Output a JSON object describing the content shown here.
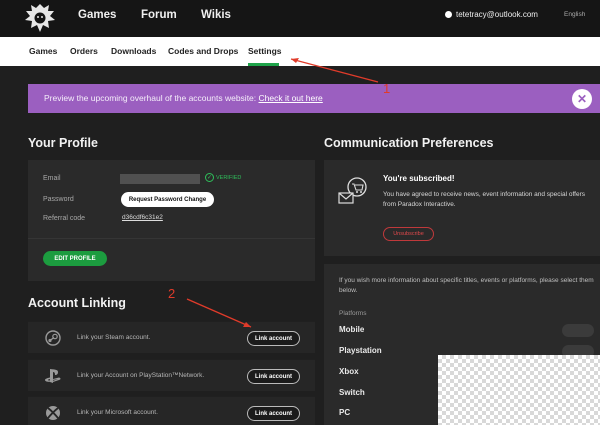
{
  "topbar": {
    "nav": [
      "Games",
      "Forum",
      "Wikis"
    ],
    "account_email": "tetetracy@outlook.com",
    "language": "English",
    "logo_icon": "lion-logo-icon"
  },
  "subnav": {
    "items": [
      "Games",
      "Orders",
      "Downloads",
      "Codes and Drops",
      "Settings"
    ],
    "active": "Settings",
    "active_color": "#1fa34a"
  },
  "banner": {
    "text": "Preview the upcoming overhaul of the accounts website: ",
    "link": "Check it out here",
    "close": "✕",
    "color": "#9b5fc0"
  },
  "profile": {
    "title": "Your Profile",
    "email_label": "Email",
    "verified": "VERIFIED",
    "password_label": "Password",
    "password_button": "Request Password Change",
    "referral_label": "Referral code",
    "referral_code": "d36cdf6c31e2",
    "edit_button": "EDIT PROFILE"
  },
  "linking": {
    "title": "Account Linking",
    "rows": [
      {
        "icon": "steam-icon",
        "text": "Link your Steam account.",
        "button": "Link account"
      },
      {
        "icon": "playstation-icon",
        "text": "Link your Account on PlayStation™Network.",
        "button": "Link account"
      },
      {
        "icon": "xbox-icon",
        "text": "Link your Microsoft account.",
        "button": "Link account"
      }
    ]
  },
  "communication": {
    "title": "Communication Preferences",
    "subscribed_title": "You're subscribed!",
    "subscribed_body": "You have agreed to receive news, event information and special offers from Paradox Interactive.",
    "unsubscribe": "Unsubscribe",
    "info_text": "If you wish more information about specific titles, events or platforms, please select them below.",
    "platforms_label": "Platforms",
    "platforms": [
      "Mobile",
      "Playstation",
      "Xbox",
      "Switch",
      "PC"
    ]
  },
  "annotations": {
    "one": "1",
    "two": "2",
    "color": "#e03b2a"
  }
}
